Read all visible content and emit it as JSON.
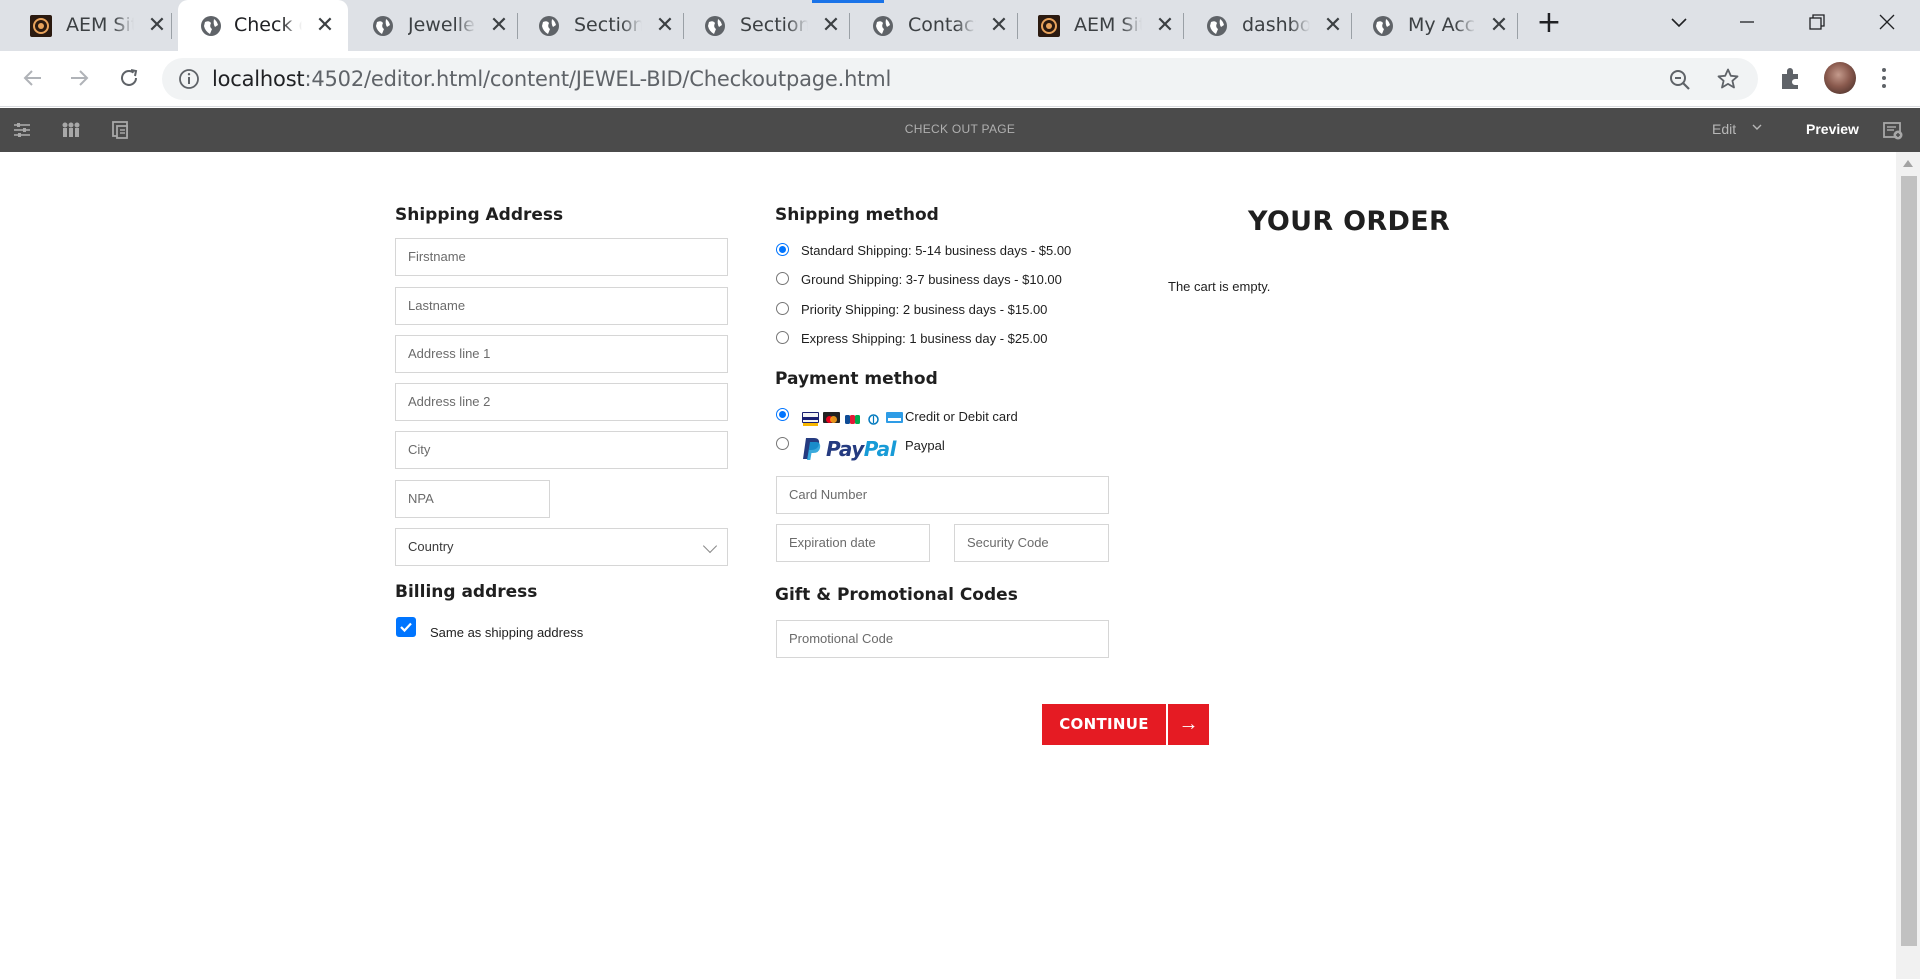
{
  "browser": {
    "tabs": [
      {
        "title": "AEM Sites",
        "favicon": "aem-icon",
        "active": false
      },
      {
        "title": "Check out",
        "favicon": "globe-icon",
        "active": true
      },
      {
        "title": "Jewellery",
        "favicon": "globe-icon",
        "active": false
      },
      {
        "title": "Section F",
        "favicon": "globe-icon",
        "active": false
      },
      {
        "title": "Section F",
        "favicon": "globe-icon",
        "active": false
      },
      {
        "title": "Contact U",
        "favicon": "globe-icon",
        "active": false
      },
      {
        "title": "AEM Sites",
        "favicon": "aem-icon",
        "active": false
      },
      {
        "title": "dashboard",
        "favicon": "globe-icon",
        "active": false
      },
      {
        "title": "My Accou",
        "favicon": "globe-icon",
        "active": false
      }
    ],
    "new_tab_symbol": "+",
    "url_host": "localhost",
    "url_rest": ":4502/editor.html/content/JEWEL-BID/Checkoutpage.html"
  },
  "editor": {
    "page_name": "CHECK OUT PAGE",
    "mode_label": "Edit",
    "preview_label": "Preview"
  },
  "shipping_address": {
    "title": "Shipping Address",
    "firstname_placeholder": "Firstname",
    "lastname_placeholder": "Lastname",
    "address1_placeholder": "Address line 1",
    "address2_placeholder": "Address line 2",
    "city_placeholder": "City",
    "npa_placeholder": "NPA",
    "country_value": "Country"
  },
  "billing_address": {
    "title": "Billing address",
    "same_as_shipping_label": "Same as shipping address",
    "same_as_shipping_checked": true
  },
  "shipping_method": {
    "title": "Shipping method",
    "options": [
      {
        "label": "Standard Shipping: 5-14 business days - $5.00",
        "checked": true
      },
      {
        "label": "Ground Shipping: 3-7 business days - $10.00",
        "checked": false
      },
      {
        "label": "Priority Shipping: 2 business days - $15.00",
        "checked": false
      },
      {
        "label": "Express Shipping: 1 business day - $25.00",
        "checked": false
      }
    ]
  },
  "payment_method": {
    "title": "Payment method",
    "card_option_label": "Credit or Debit card",
    "card_option_checked": true,
    "card_brand_icons": [
      "visa-icon",
      "mastercard-icon",
      "jcb-icon",
      "diners-icon",
      "amex-icon"
    ],
    "paypal_logo_text_1": "Pay",
    "paypal_logo_text_2": "Pal",
    "paypal_option_label": "Paypal",
    "card_number_placeholder": "Card Number",
    "expiration_placeholder": "Expiration date",
    "security_code_placeholder": "Security Code"
  },
  "promo": {
    "title": "Gift & Promotional Codes",
    "code_placeholder": "Promotional Code"
  },
  "order": {
    "title": "YOUR ORDER",
    "empty_message": "The cart is empty."
  },
  "actions": {
    "continue_label": "CONTINUE",
    "continue_arrow": "→"
  },
  "colors": {
    "accent_red": "#e51b23",
    "radio_blue": "#0075ff",
    "aem_bar": "#4b4b4b"
  }
}
